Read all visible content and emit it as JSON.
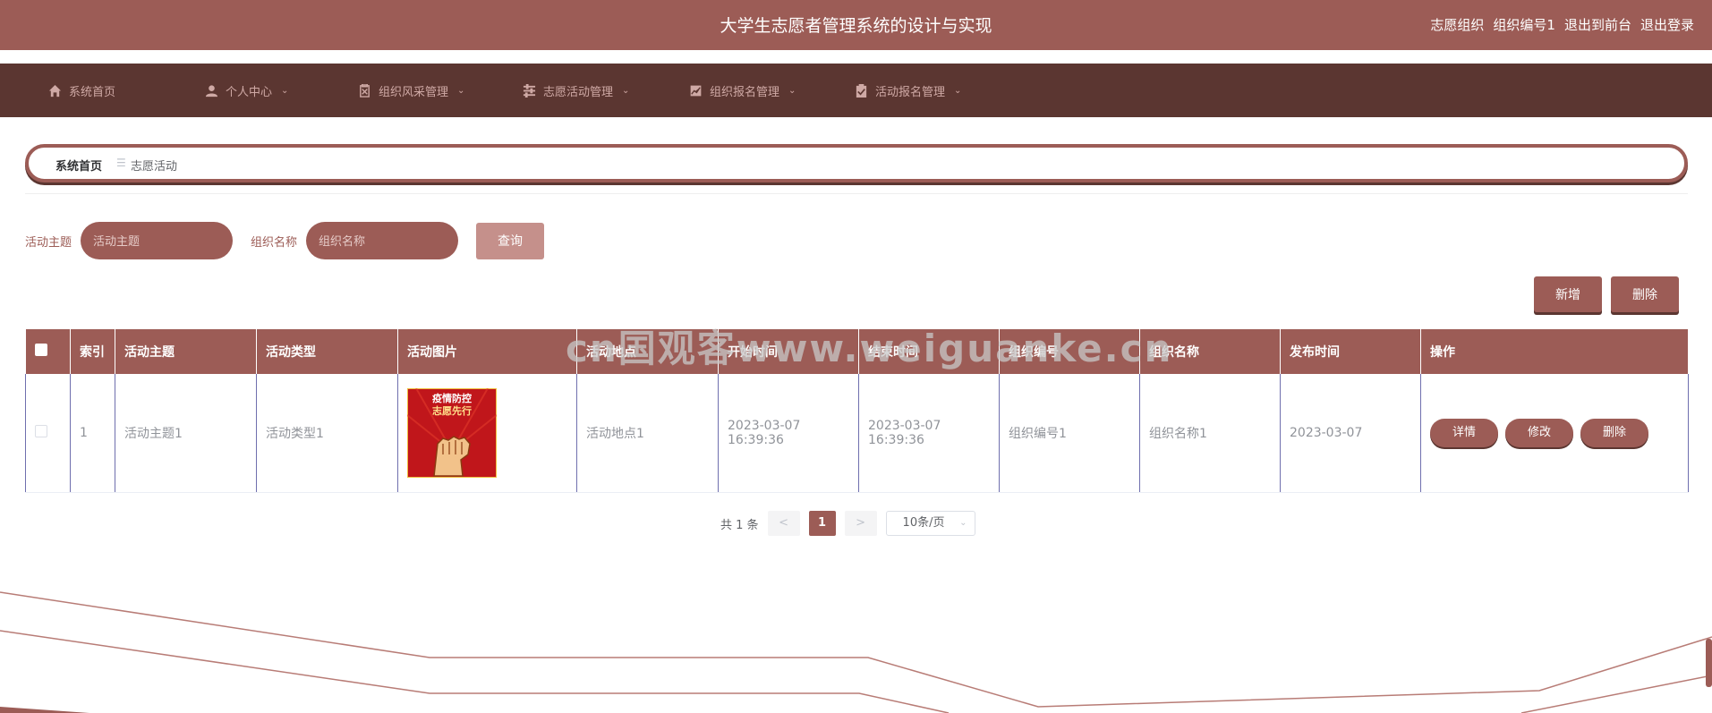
{
  "header": {
    "title": "大学生志愿者管理系统的设计与实现",
    "user_role": "志愿组织",
    "user_name": "组织编号1",
    "to_front": "退出到前台",
    "logout": "退出登录"
  },
  "nav": {
    "items": [
      {
        "label": "系统首页",
        "icon": "home-icon",
        "has_arrow": false
      },
      {
        "label": "个人中心",
        "icon": "user-icon",
        "has_arrow": true
      },
      {
        "label": "组织风采管理",
        "icon": "clipboard-icon",
        "has_arrow": true
      },
      {
        "label": "志愿活动管理",
        "icon": "sliders-icon",
        "has_arrow": true
      },
      {
        "label": "组织报名管理",
        "icon": "chart-icon",
        "has_arrow": true
      },
      {
        "label": "活动报名管理",
        "icon": "check-clipboard-icon",
        "has_arrow": true
      }
    ]
  },
  "breadcrumb": {
    "home": "系统首页",
    "separator": "☰",
    "current": "志愿活动"
  },
  "search": {
    "topic_label": "活动主题",
    "topic_placeholder": "活动主题",
    "org_label": "组织名称",
    "org_placeholder": "组织名称",
    "query_button": "查询"
  },
  "actions": {
    "add_button": "新增",
    "delete_button": "删除"
  },
  "table": {
    "columns": [
      "索引",
      "活动主题",
      "活动类型",
      "活动图片",
      "活动地点",
      "开始时间",
      "结束时间",
      "组织编号",
      "组织名称",
      "发布时间",
      "操作"
    ],
    "rows": [
      {
        "index": "1",
        "topic": "活动主题1",
        "type": "活动类型1",
        "image_text_line1": "疫情防控",
        "image_text_line2": "志愿先行",
        "location": "活动地点1",
        "start_time": "2023-03-07 16:39:36",
        "end_time": "2023-03-07 16:39:36",
        "org_code": "组织编号1",
        "org_name": "组织名称1",
        "publish_time": "2023-03-07",
        "op_detail": "详情",
        "op_edit": "修改",
        "op_delete": "删除"
      }
    ]
  },
  "pagination": {
    "total_text": "共 1 条",
    "prev": "<",
    "current_page": "1",
    "next": ">",
    "page_size": "10条/页"
  },
  "watermark": "cn国观客www.weiguanke.cn",
  "colors": {
    "primary": "#9c5c56",
    "nav_bg": "#5b3631",
    "accent_light": "#c5908b"
  }
}
